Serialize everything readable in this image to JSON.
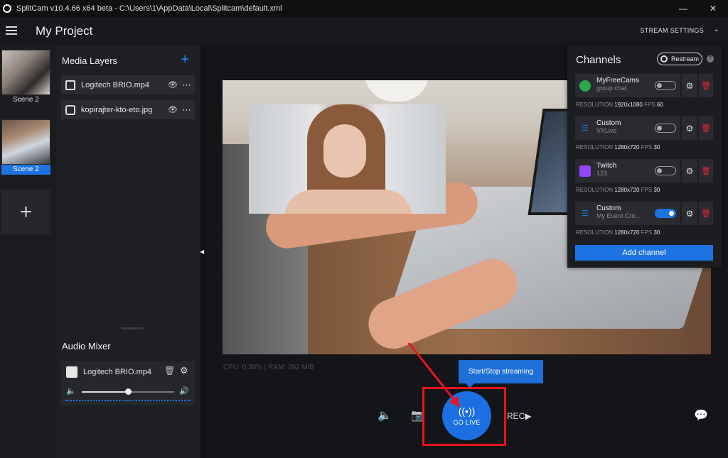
{
  "window": {
    "title": "SplitCam v10.4.66 x64 beta - C:\\Users\\1\\AppData\\Local\\Splitcam\\default.xml",
    "minimize": "—",
    "close": "✕"
  },
  "header": {
    "project_title": "My Project",
    "stream_settings": "STREAM SETTINGS",
    "chevron": "⌄"
  },
  "scenes": {
    "items": [
      {
        "label": "Scene 2",
        "active": false
      },
      {
        "label": "Scene 2",
        "active": true
      }
    ],
    "add_label": "+"
  },
  "media_layers": {
    "title": "Media Layers",
    "add": "+",
    "items": [
      {
        "name": "Logitech BRIO.mp4",
        "icon": "video-icon"
      },
      {
        "name": "kopirajter-kto-eto.jpg",
        "icon": "image-icon"
      }
    ],
    "visibility_icon": "eye-icon",
    "more_icon": "⋯"
  },
  "audio_mixer": {
    "title": "Audio Mixer",
    "items": [
      {
        "name": "Logitech BRIO.mp4",
        "volume": 0.5
      }
    ]
  },
  "stats": {
    "text": "CPU: 0,39% | RAM: 292 MiB"
  },
  "tooltip": {
    "text": "Start/Stop streaming"
  },
  "go_live": {
    "label": "GO LIVE",
    "signal": "((•))"
  },
  "bottom_bar": {
    "audio_icon": "speaker-icon",
    "snapshot_icon": "camera-icon",
    "record_icon": "rec-icon",
    "chat_icon": "chat-icon"
  },
  "channels": {
    "title": "Channels",
    "restream": "Restream",
    "help": "?",
    "res_label": "RESOLUTION",
    "fps_label": "FPS",
    "items": [
      {
        "name": "MyFreeCams",
        "sub": "group chat",
        "enabled": false,
        "resolution": "1920x1080",
        "fps": "60",
        "color": "#2aa84a"
      },
      {
        "name": "Custom",
        "sub": "VXLive",
        "enabled": false,
        "resolution": "1280x720",
        "fps": "30",
        "color": "#1e73e3"
      },
      {
        "name": "Twitch",
        "sub": "123",
        "enabled": false,
        "resolution": "1280x720",
        "fps": "30",
        "color": "#9146ff"
      },
      {
        "name": "Custom",
        "sub": "My Event Cro...",
        "enabled": true,
        "resolution": "1280x720",
        "fps": "30",
        "color": "#1e73e3"
      }
    ],
    "add_channel": "Add channel"
  },
  "colors": {
    "accent": "#1e73e3",
    "highlight": "#e8141c",
    "danger": "#e0262e"
  }
}
